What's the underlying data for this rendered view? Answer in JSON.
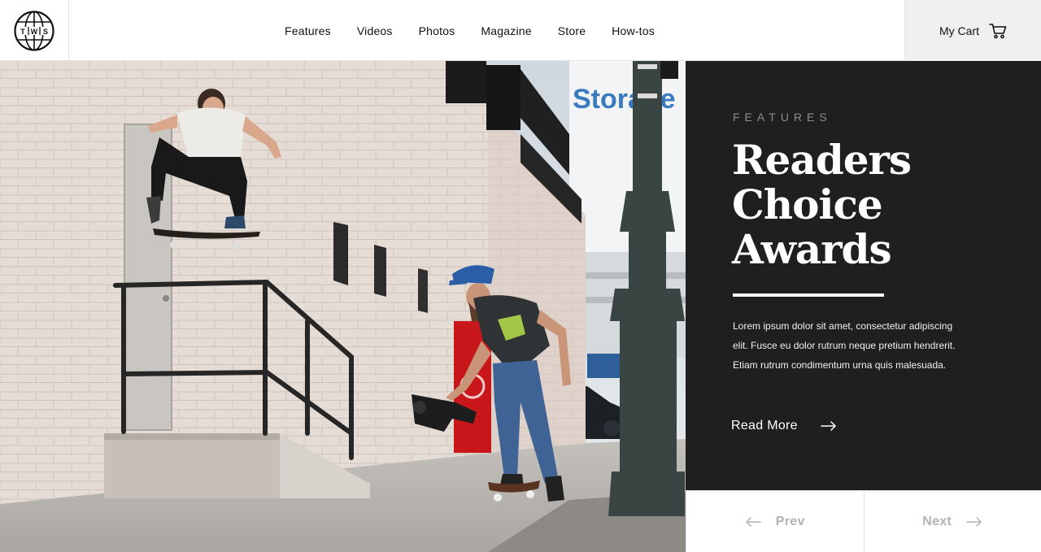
{
  "brand": {
    "logo_letters": [
      "T",
      "W",
      "S"
    ],
    "logo_icon": "globe-icon"
  },
  "nav": {
    "items": [
      {
        "label": "Features"
      },
      {
        "label": "Videos"
      },
      {
        "label": "Photos"
      },
      {
        "label": "Magazine"
      },
      {
        "label": "Store"
      },
      {
        "label": "How-tos"
      }
    ]
  },
  "cart": {
    "label": "My Cart",
    "icon": "cart-icon"
  },
  "hero": {
    "image_subject": "skateboarder-photo",
    "sign_text": "Storage"
  },
  "feature": {
    "kicker": "FEATURES",
    "title_line1": "Readers",
    "title_line2": "Choice",
    "title_line3": "Awards",
    "description": "Lorem ipsum dolor sit amet, consectetur adipiscing elit. Fusce eu dolor rutrum neque pretium hendrerit. Etiam rutrum condimentum urna quis malesuada.",
    "read_more_label": "Read More",
    "read_more_icon": "arrow-right-icon"
  },
  "pager": {
    "prev_label": "Prev",
    "prev_icon": "arrow-left-icon",
    "next_label": "Next",
    "next_icon": "arrow-right-icon"
  },
  "colors": {
    "panel_bg": "#1f1f1f",
    "kicker": "#8d8d8d",
    "pager_text": "#b3b3b3",
    "cart_bg": "#f0f0f0"
  }
}
